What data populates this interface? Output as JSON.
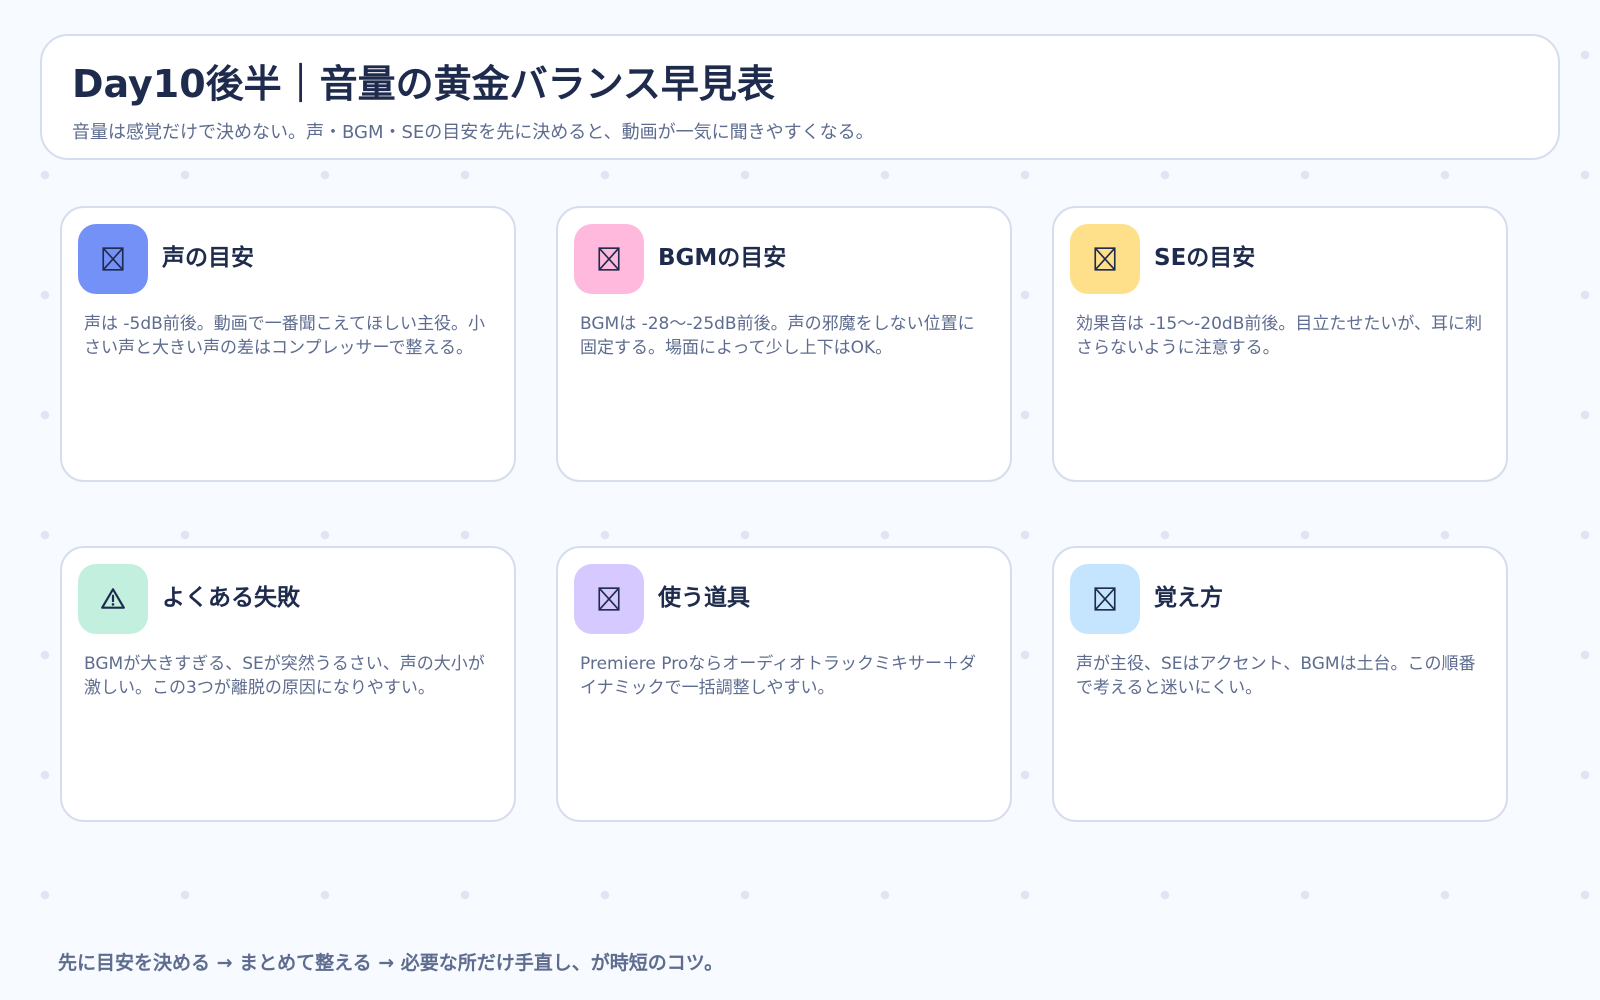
{
  "header": {
    "title": "Day10後半｜音量の黄金バランス早見表",
    "subtitle": "音量は感覚だけで決めない。声・BGM・SEの目安を先に決めると、動画が一気に聞きやすくなる。"
  },
  "cards": [
    {
      "title": "声の目安",
      "body": "声は -5dB前後。動画で一番聞こえてほしい主役。小さい声と大きい声の差はコンプレッサーで整える。",
      "icon": "missing-image-icon",
      "color": "#7391f7"
    },
    {
      "title": "BGMの目安",
      "body": "BGMは -28〜-25dB前後。声の邪魔をしない位置に固定する。場面によって少し上下はOK。",
      "icon": "missing-image-icon",
      "color": "#ffb9dc"
    },
    {
      "title": "SEの目安",
      "body": "効果音は -15〜-20dB前後。目立たせたいが、耳に刺さらないように注意する。",
      "icon": "missing-image-icon",
      "color": "#ffe08a"
    },
    {
      "title": "よくある失敗",
      "body": "BGMが大きすぎる、SEが突然うるさい、声の大小が激しい。この3つが離脱の原因になりやすい。",
      "icon": "warning-icon",
      "color": "#c3efdf"
    },
    {
      "title": "使う道具",
      "body": "Premiere Proならオーディオトラックミキサー＋ダイナミックで一括調整しやすい。",
      "icon": "missing-image-icon",
      "color": "#d5c9ff"
    },
    {
      "title": "覚え方",
      "body": "声が主役、SEはアクセント、BGMは土台。この順番で考えると迷いにくい。",
      "icon": "missing-image-icon",
      "color": "#c4e5fd"
    }
  ],
  "footer": {
    "text": "先に目安を決める → まとめて整える → 必要な所だけ手直し、が時短のコツ。"
  }
}
